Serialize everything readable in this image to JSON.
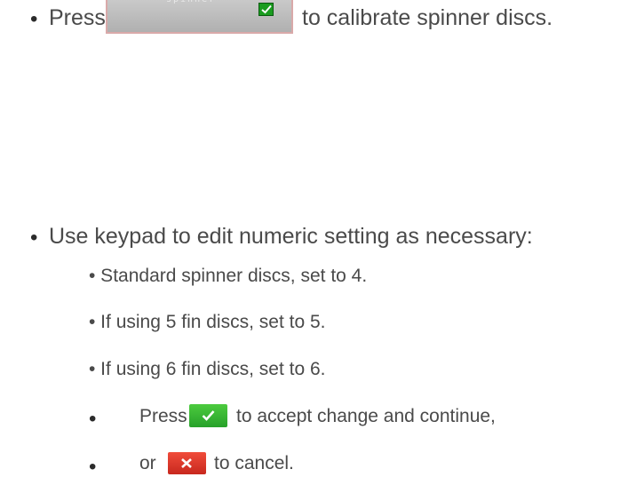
{
  "step1": {
    "bullet": "•",
    "press_label": "Press",
    "spinner_key_caption": "spinner",
    "after_text": "to calibrate spinner discs."
  },
  "step2": {
    "bullet": "•",
    "intro": "Use keypad to edit numeric setting as necessary:",
    "options": [
      "• Standard spinner discs, set to 4.",
      "• If using 5 fin discs, set to 5.",
      "• If using 6 fin discs, set to 6."
    ],
    "accept_bullet": "•",
    "accept_prefix": "Press",
    "accept_suffix": "to accept change and continue,",
    "cancel_bullet": "•",
    "cancel_prefix": "or",
    "cancel_suffix": "to cancel."
  },
  "colors": {
    "accept": "#2fae2f",
    "cancel": "#d93025"
  }
}
